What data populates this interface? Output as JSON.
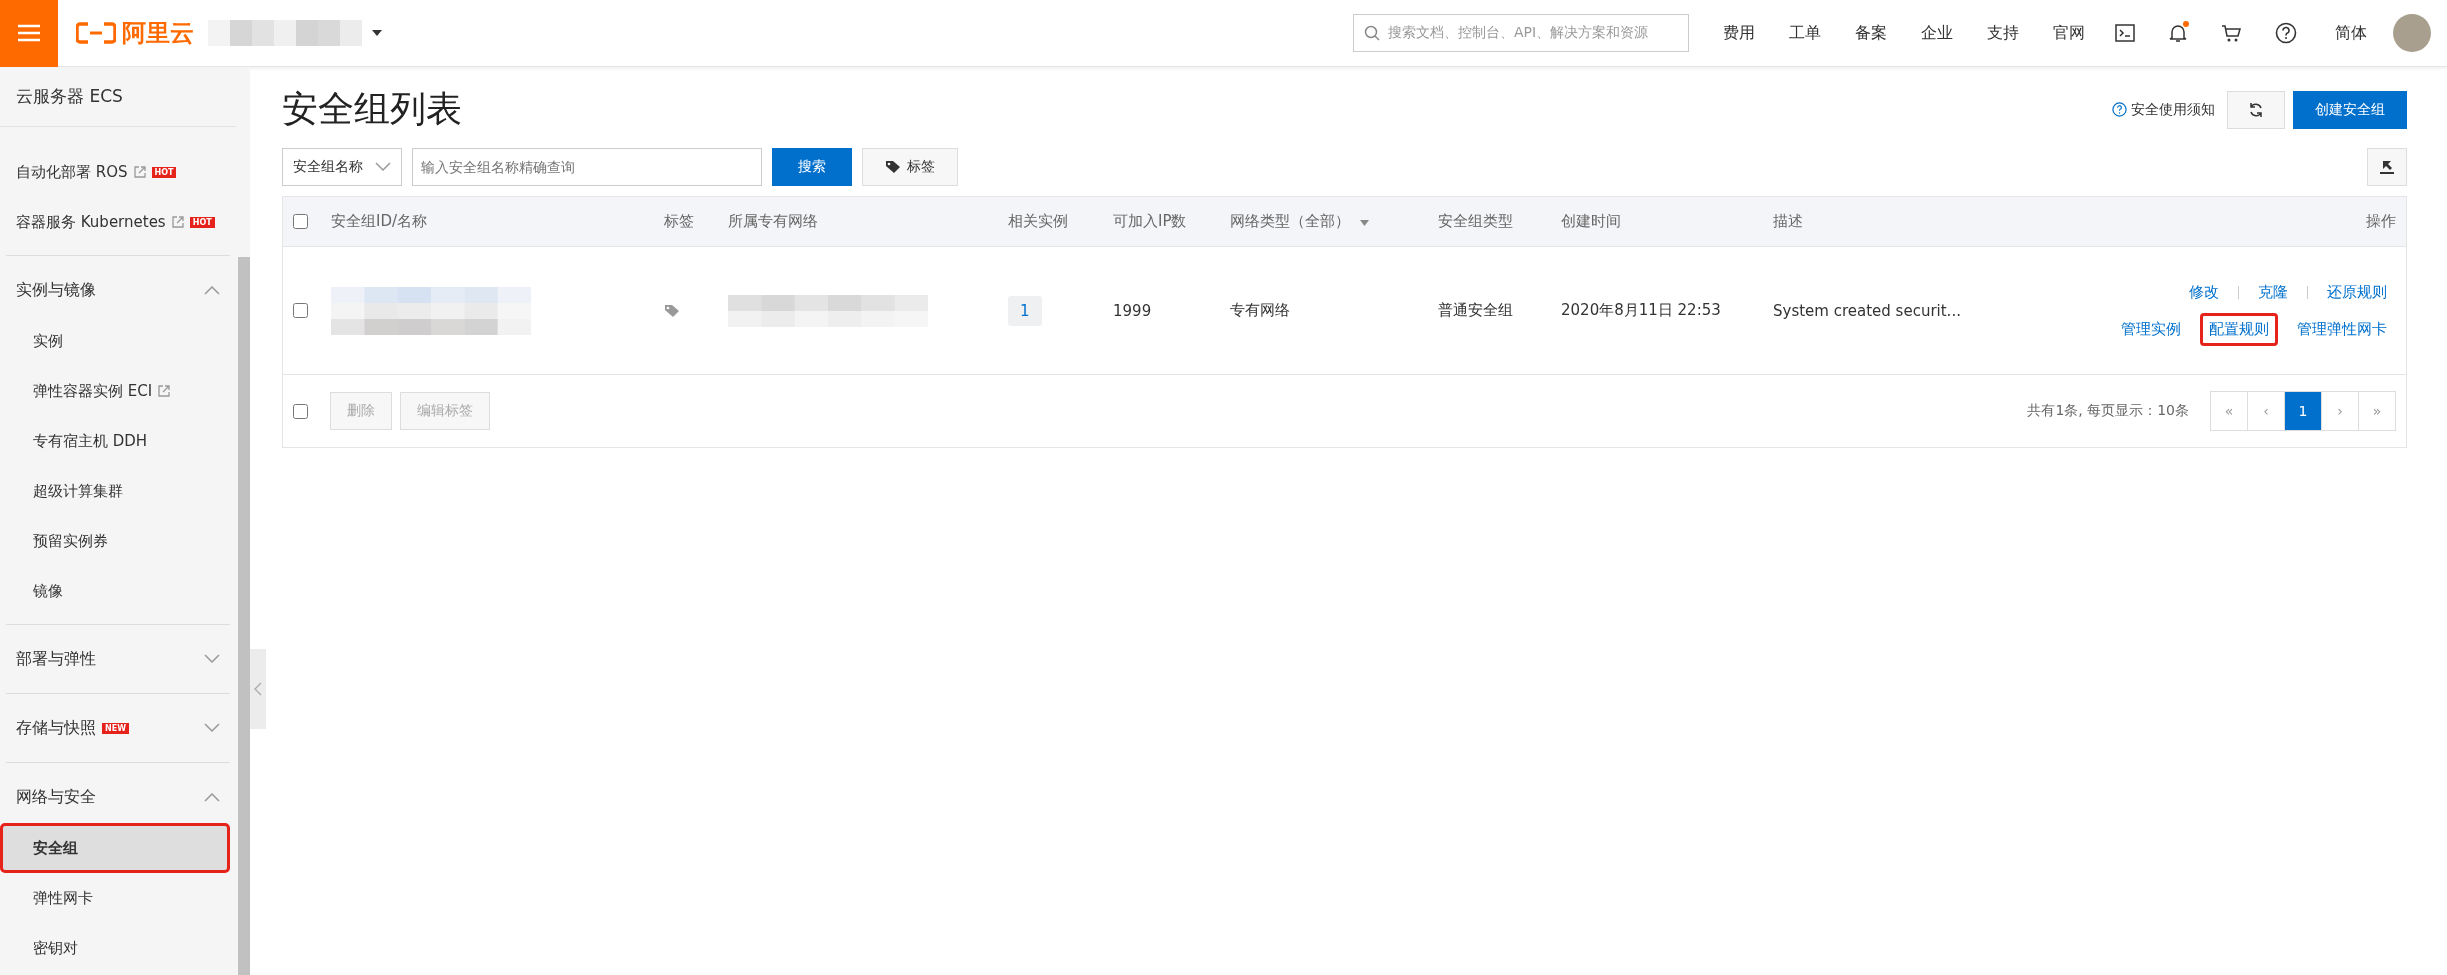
{
  "topbar": {
    "logo": "阿里云",
    "search": {
      "placeholder": "搜索文档、控制台、API、解决方案和资源"
    },
    "nav": [
      "费用",
      "工单",
      "备案",
      "企业",
      "支持",
      "官网"
    ],
    "icons": [
      {
        "kind": "terminal",
        "dot": false
      },
      {
        "kind": "bell",
        "dot": true
      },
      {
        "kind": "cart",
        "dot": false
      },
      {
        "kind": "help",
        "dot": false
      }
    ],
    "language": "简体"
  },
  "sidebar": {
    "title": "云服务器 ECS",
    "groups": [
      {
        "items": [
          {
            "label": "自动化部署 ROS",
            "external": true,
            "badge": "HOT",
            "selected": false,
            "highlighted": false
          },
          {
            "label": "容器服务 Kubernetes",
            "external": true,
            "badge": "HOT",
            "selected": false,
            "highlighted": false
          }
        ]
      },
      {
        "label": "实例与镜像",
        "expanded": true,
        "items": [
          {
            "label": "实例",
            "external": false,
            "selected": false,
            "highlighted": false
          },
          {
            "label": "弹性容器实例 ECI",
            "external": true,
            "selected": false,
            "highlighted": false
          },
          {
            "label": "专有宿主机 DDH",
            "external": false,
            "selected": false,
            "highlighted": false
          },
          {
            "label": "超级计算集群",
            "external": false,
            "selected": false,
            "highlighted": false
          },
          {
            "label": "预留实例券",
            "external": false,
            "selected": false,
            "highlighted": false
          },
          {
            "label": "镜像",
            "external": false,
            "selected": false,
            "highlighted": false
          }
        ]
      },
      {
        "label": "部署与弹性",
        "expanded": false
      },
      {
        "label": "存储与快照",
        "badge": "NEW",
        "expanded": false
      },
      {
        "label": "网络与安全",
        "expanded": true,
        "items": [
          {
            "label": "安全组",
            "external": false,
            "selected": true,
            "highlighted": true
          },
          {
            "label": "弹性网卡",
            "external": false,
            "selected": false,
            "highlighted": false
          },
          {
            "label": "密钥对",
            "external": false,
            "selected": false,
            "highlighted": false
          }
        ]
      }
    ]
  },
  "page": {
    "title": "安全组列表",
    "notice": "安全使用须知",
    "create_button": "创建安全组",
    "filter_select": "安全组名称",
    "search": {
      "placeholder": "输入安全组名称精确查询"
    },
    "search_button": "搜索",
    "tag_button": "标签"
  },
  "table": {
    "header_checked": false,
    "columns": [
      "安全组ID/名称",
      "标签",
      "所属专有网络",
      "相关实例",
      "可加入IP数",
      "网络类型（全部）",
      "安全组类型",
      "创建时间",
      "描述",
      "操作"
    ],
    "rows": [
      {
        "checked": false,
        "instances": "1",
        "ips": "1999",
        "network": "专有网络",
        "type": "普通安全组",
        "created": "2020年8月11日 22:53",
        "description": "System created securit...",
        "actions": [
          {
            "label": "修改",
            "highlighted": false
          },
          {
            "label": "克隆",
            "highlighted": false
          },
          {
            "label": "还原规则",
            "highlighted": false
          },
          {
            "label": "管理实例",
            "highlighted": false
          },
          {
            "label": "配置规则",
            "highlighted": true
          },
          {
            "label": "管理弹性网卡",
            "highlighted": false
          }
        ]
      }
    ],
    "footer_checked": false,
    "footer_buttons": [
      "删除",
      "编辑标签"
    ],
    "summary": "共有1条, 每页显示：10条",
    "pages": [
      {
        "label": "«",
        "selected": false
      },
      {
        "label": "‹",
        "selected": false
      },
      {
        "label": "1",
        "selected": true
      },
      {
        "label": "›",
        "selected": false
      },
      {
        "label": "»",
        "selected": false
      }
    ]
  }
}
